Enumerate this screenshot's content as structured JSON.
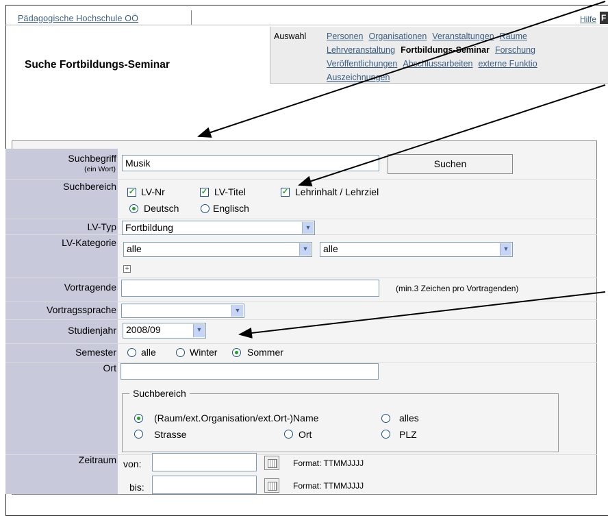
{
  "header": {
    "institution_link": "Pädagogische Hochschule OÖ",
    "help_link": "Hilfe",
    "help_box_letter": "F",
    "page_title": "Suche Fortbildungs-Seminar"
  },
  "nav": {
    "label": "Auswahl",
    "row1": [
      "Personen",
      "Organisationen",
      "Veranstaltungen",
      "Räume"
    ],
    "row2": [
      "Lehrveranstaltung",
      "Fortbildungs-Seminar",
      "Forschung"
    ],
    "row3": [
      "Veröffentlichungen",
      "Abschlussarbeiten",
      "externe Funktio"
    ],
    "row4": [
      "Auszeichnungen"
    ],
    "current": "Fortbildungs-Seminar"
  },
  "form": {
    "suchbegriff": {
      "label": "Suchbegriff",
      "sublabel": "(ein Wort)",
      "value": "Musik",
      "button": "Suchen"
    },
    "suchbereich": {
      "label": "Suchbereich",
      "checkboxes": [
        {
          "label": "LV-Nr",
          "checked": true
        },
        {
          "label": "LV-Titel",
          "checked": true
        },
        {
          "label": "Lehrinhalt / Lehrziel",
          "checked": true
        }
      ],
      "languages": [
        {
          "label": "Deutsch",
          "selected": true
        },
        {
          "label": "Englisch",
          "selected": false
        }
      ]
    },
    "lv_typ": {
      "label": "LV-Typ",
      "value": "Fortbildung"
    },
    "lv_kategorie": {
      "label": "LV-Kategorie",
      "value1": "alle",
      "value2": "alle"
    },
    "vortragende": {
      "label": "Vortragende",
      "value": "",
      "hint": "(min.3 Zeichen pro Vortragenden)"
    },
    "vortragssprache": {
      "label": "Vortragssprache",
      "value": ""
    },
    "studienjahr": {
      "label": "Studienjahr",
      "value": "2008/09"
    },
    "semester": {
      "label": "Semester",
      "options": [
        {
          "label": "alle",
          "selected": false
        },
        {
          "label": "Winter",
          "selected": false
        },
        {
          "label": "Sommer",
          "selected": true
        }
      ]
    },
    "ort": {
      "label": "Ort",
      "value": "",
      "fieldset_legend": "Suchbereich",
      "options": [
        {
          "label": "(Raum/ext.Organisation/ext.Ort-)Name",
          "selected": true
        },
        {
          "label": "alles",
          "selected": false
        },
        {
          "label": "Strasse",
          "selected": false
        },
        {
          "label": "Ort",
          "selected": false
        },
        {
          "label": "PLZ",
          "selected": false
        }
      ]
    },
    "zeitraum": {
      "label": "Zeitraum",
      "von_label": "von:",
      "bis_label": "bis:",
      "von_value": "",
      "bis_value": "",
      "format_hint": "Format: TTMMJJJJ"
    }
  },
  "colors": {
    "link": "#3a5e82",
    "label_column": "#c8cadc",
    "check_mark": "#21a121",
    "select_arrow_bg": "#c6d5f5"
  }
}
